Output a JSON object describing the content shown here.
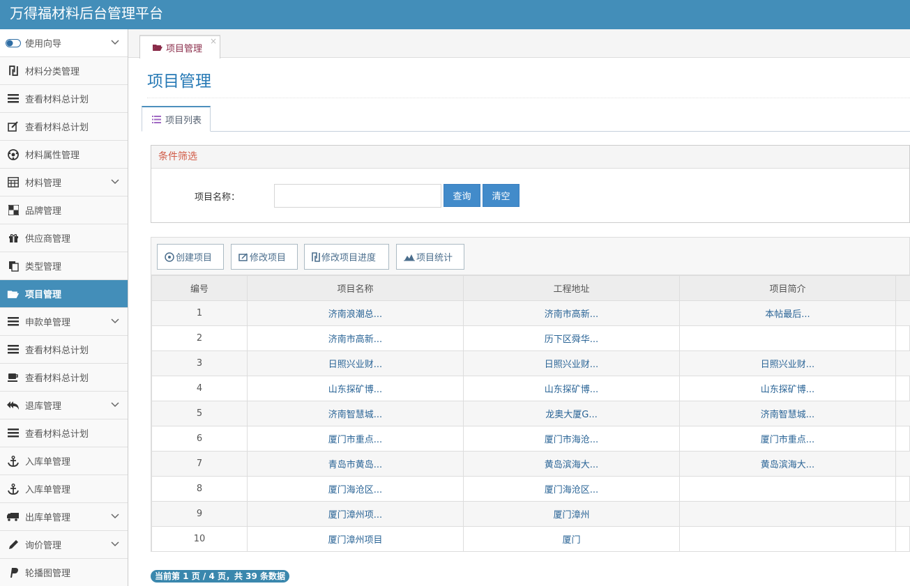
{
  "app": {
    "title": "万得福材料后台管理平台"
  },
  "sidebar": {
    "items": [
      {
        "label": "使用向导",
        "icon": "toggle-icon",
        "chevron": true
      },
      {
        "label": "材料分类管理",
        "icon": "shekel-icon",
        "chevron": false
      },
      {
        "label": "查看材料总计划",
        "icon": "list-icon",
        "chevron": false
      },
      {
        "label": "查看材料总计划",
        "icon": "edit-icon",
        "chevron": false
      },
      {
        "label": "材料属性管理",
        "icon": "soccer-ball-icon",
        "chevron": false
      },
      {
        "label": "材料管理",
        "icon": "calculator-icon",
        "chevron": true
      },
      {
        "label": "品牌管理",
        "icon": "checkerboard-icon",
        "chevron": false
      },
      {
        "label": "供应商管理",
        "icon": "gift-icon",
        "chevron": false
      },
      {
        "label": "类型管理",
        "icon": "copy-icon",
        "chevron": false
      },
      {
        "label": "项目管理",
        "icon": "folder-open-icon",
        "chevron": false,
        "active": true
      },
      {
        "label": "申款单管理",
        "icon": "list-icon",
        "chevron": true
      },
      {
        "label": "查看材料总计划",
        "icon": "list-icon",
        "chevron": false
      },
      {
        "label": "查看材料总计划",
        "icon": "coffee-icon",
        "chevron": false
      },
      {
        "label": "退库管理",
        "icon": "reply-all-icon",
        "chevron": true
      },
      {
        "label": "查看材料总计划",
        "icon": "list-icon",
        "chevron": false
      },
      {
        "label": "入库单管理",
        "icon": "anchor-icon",
        "chevron": false
      },
      {
        "label": "入库单管理",
        "icon": "anchor-icon",
        "chevron": false
      },
      {
        "label": "出库单管理",
        "icon": "truck-icon",
        "chevron": true
      },
      {
        "label": "询价管理",
        "icon": "pencil-icon",
        "chevron": true
      },
      {
        "label": "轮播图管理",
        "icon": "paypal-icon",
        "chevron": false
      }
    ]
  },
  "tab": {
    "label": "项目管理",
    "close": "×"
  },
  "page": {
    "title": "项目管理"
  },
  "subtab": {
    "label": "项目列表"
  },
  "filter": {
    "heading": "条件筛选",
    "name_label": "项目名称：",
    "name_value": "",
    "query_button": "查询",
    "clear_button": "清空"
  },
  "toolbar": {
    "create": "创建项目",
    "edit": "修改项目",
    "progress": "修改项目进度",
    "stats": "项目统计"
  },
  "table": {
    "headers": [
      "编号",
      "项目名称",
      "工程地址",
      "项目简介"
    ],
    "rows": [
      [
        "1",
        "济南浪潮总...",
        "济南市高新...",
        "本帖最后..."
      ],
      [
        "2",
        "济南市高新...",
        "历下区舜华...",
        ""
      ],
      [
        "3",
        "日照兴业财...",
        "日照兴业财...",
        "日照兴业财..."
      ],
      [
        "4",
        "山东探矿博...",
        "山东探矿博...",
        "山东探矿博..."
      ],
      [
        "5",
        "济南智慧城...",
        "龙奥大厦G...",
        "济南智慧城..."
      ],
      [
        "6",
        "厦门市重点...",
        "厦门市海沧...",
        "厦门市重点..."
      ],
      [
        "7",
        "青岛市黄岛...",
        "黄岛滨海大...",
        "黄岛滨海大..."
      ],
      [
        "8",
        "厦门海沧区...",
        "厦门海沧区...",
        ""
      ],
      [
        "9",
        "厦门漳州项...",
        "厦门漳州",
        ""
      ],
      [
        "10",
        "厦门漳州项目",
        "厦门",
        ""
      ]
    ]
  },
  "pager": {
    "text": "当前第 1 页 / 4 页，共 39 条数据"
  },
  "colors": {
    "header": "#438eb9",
    "active": "#438eb9",
    "accent": "#d15b47"
  }
}
